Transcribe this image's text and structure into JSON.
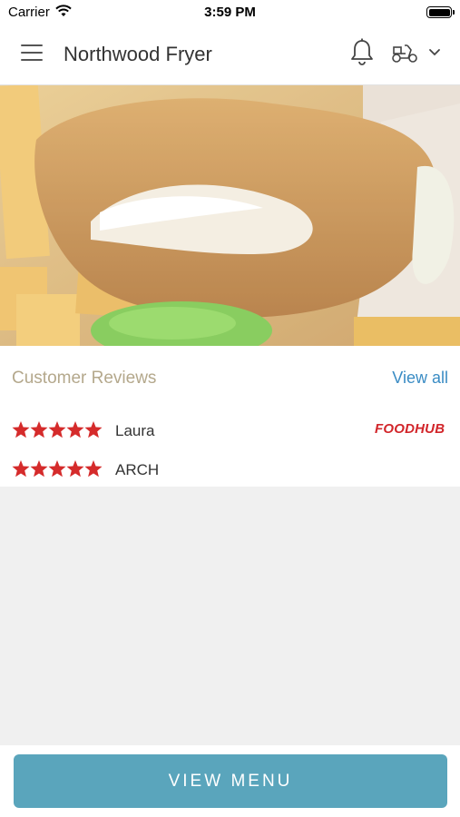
{
  "status_bar": {
    "carrier": "Carrier",
    "time": "3:59 PM"
  },
  "header": {
    "title": "Northwood Fryer",
    "icons": [
      "menu-icon",
      "bell-icon",
      "scooter-icon",
      "chevron-down-icon"
    ]
  },
  "hero": {
    "image": "fish-and-chips-photo"
  },
  "reviews": {
    "title": "Customer Reviews",
    "view_all": "View all",
    "logo_text": "FOODHUB",
    "items": [
      {
        "name": "Laura",
        "rating": 5
      },
      {
        "name": "ARCH",
        "rating": 5
      }
    ],
    "star_color": "#d52b2b"
  },
  "footer": {
    "view_menu_label": "VIEW MENU",
    "button_color": "#5aa5bc"
  }
}
